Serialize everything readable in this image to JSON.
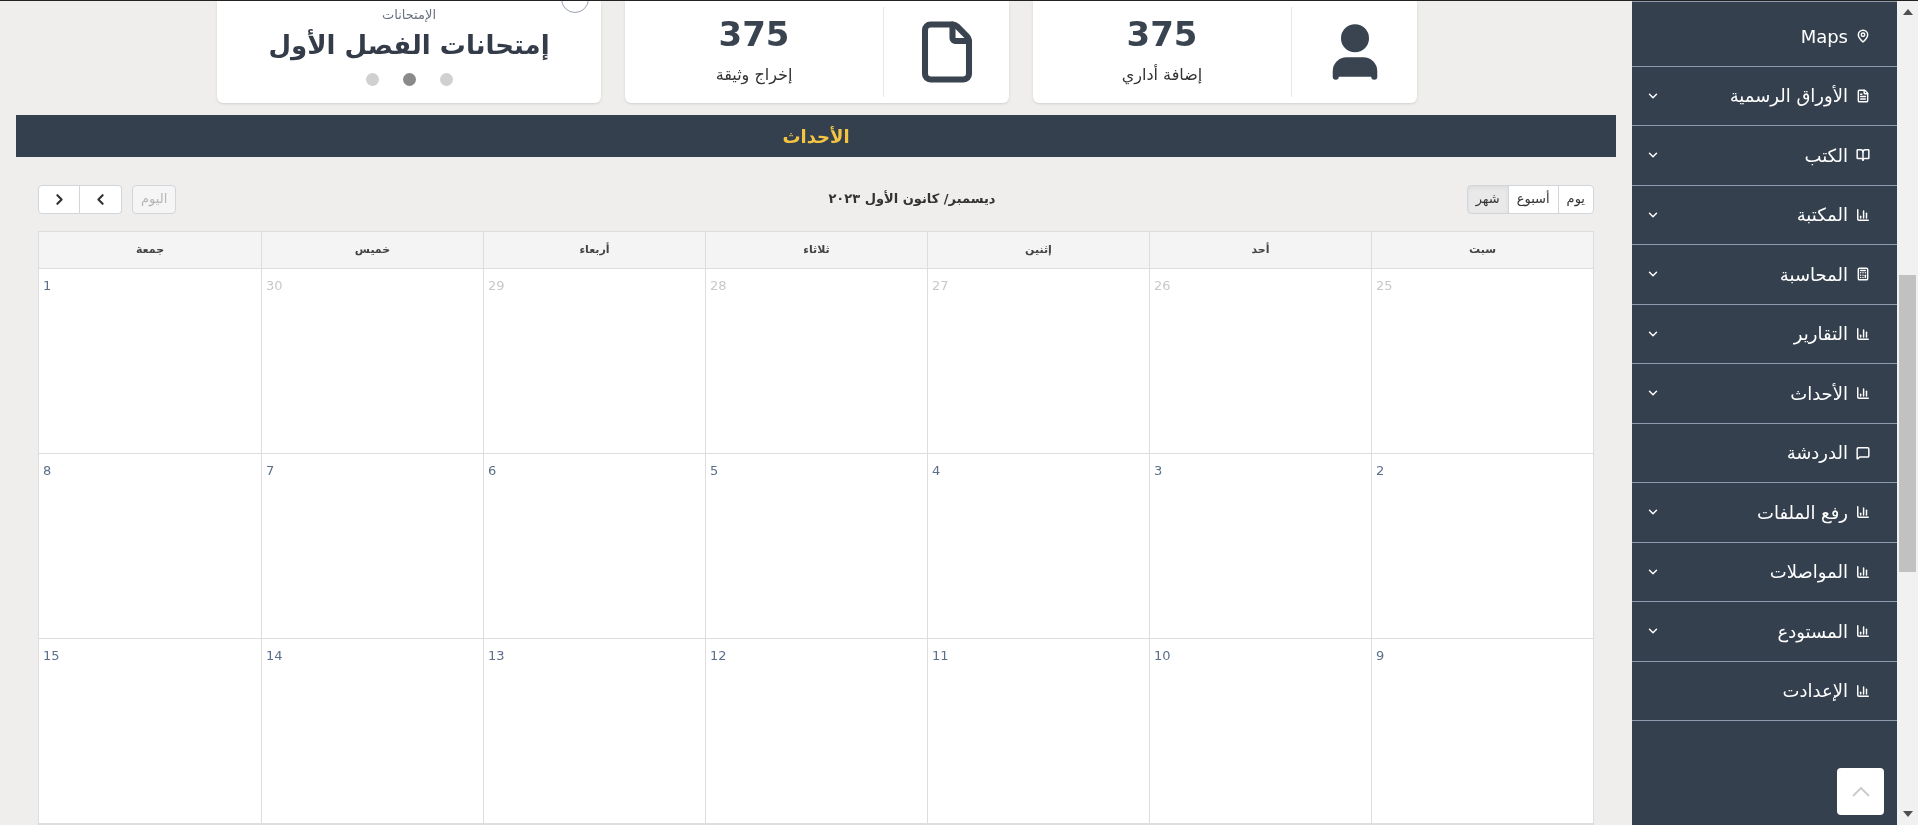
{
  "cards": [
    {
      "kind": "stat",
      "value": "375",
      "label": "إضافة أداري"
    },
    {
      "kind": "stat",
      "value": "375",
      "label": "إخراج وثيقة"
    },
    {
      "kind": "carousel",
      "caption": "الإمتحانات",
      "title": "إمتحانات الفصل الأول",
      "dots": [
        {
          "selected": false
        },
        {
          "selected": true
        },
        {
          "selected": false
        }
      ]
    }
  ],
  "banner": {
    "title": "الأحداث"
  },
  "calendar": {
    "today_button": {
      "label": "اليوم",
      "disabled": true
    },
    "title": "ديسمبر/ كانون الأول ٢٠٢٣",
    "views": [
      {
        "label": "يوم",
        "selected": false
      },
      {
        "label": "أسبوع",
        "selected": false
      },
      {
        "label": "شهر",
        "selected": true
      }
    ],
    "weekdays": [
      "سبت",
      "أحد",
      "إثنين",
      "ثلاثاء",
      "أربعاء",
      "خميس",
      "جمعة"
    ],
    "weeks": [
      [
        {
          "day": "25",
          "muted": true
        },
        {
          "day": "26",
          "muted": true
        },
        {
          "day": "27",
          "muted": true
        },
        {
          "day": "28",
          "muted": true
        },
        {
          "day": "29",
          "muted": true
        },
        {
          "day": "30",
          "muted": true
        },
        {
          "day": "1",
          "muted": false
        }
      ],
      [
        {
          "day": "2",
          "muted": false
        },
        {
          "day": "3",
          "muted": false
        },
        {
          "day": "4",
          "muted": false
        },
        {
          "day": "5",
          "muted": false
        },
        {
          "day": "6",
          "muted": false
        },
        {
          "day": "7",
          "muted": false
        },
        {
          "day": "8",
          "muted": false
        }
      ],
      [
        {
          "day": "9",
          "muted": false
        },
        {
          "day": "10",
          "muted": false
        },
        {
          "day": "11",
          "muted": false
        },
        {
          "day": "12",
          "muted": false
        },
        {
          "day": "13",
          "muted": false
        },
        {
          "day": "14",
          "muted": false
        },
        {
          "day": "15",
          "muted": false
        }
      ]
    ]
  },
  "sidebar": {
    "items": [
      {
        "label": "Maps",
        "expandable": false
      },
      {
        "label": "الأوراق الرسمية",
        "expandable": true
      },
      {
        "label": "الكتب",
        "expandable": true
      },
      {
        "label": "المكتبة",
        "expandable": true
      },
      {
        "label": "المحاسبة",
        "expandable": true
      },
      {
        "label": "التقارير",
        "expandable": true
      },
      {
        "label": "الأحداث",
        "expandable": true
      },
      {
        "label": "الدردشة",
        "expandable": false
      },
      {
        "label": "رفع الملفات",
        "expandable": true
      },
      {
        "label": "المواصلات",
        "expandable": true
      },
      {
        "label": "المستودع",
        "expandable": true
      },
      {
        "label": "الإعدادت",
        "expandable": false
      }
    ]
  }
}
